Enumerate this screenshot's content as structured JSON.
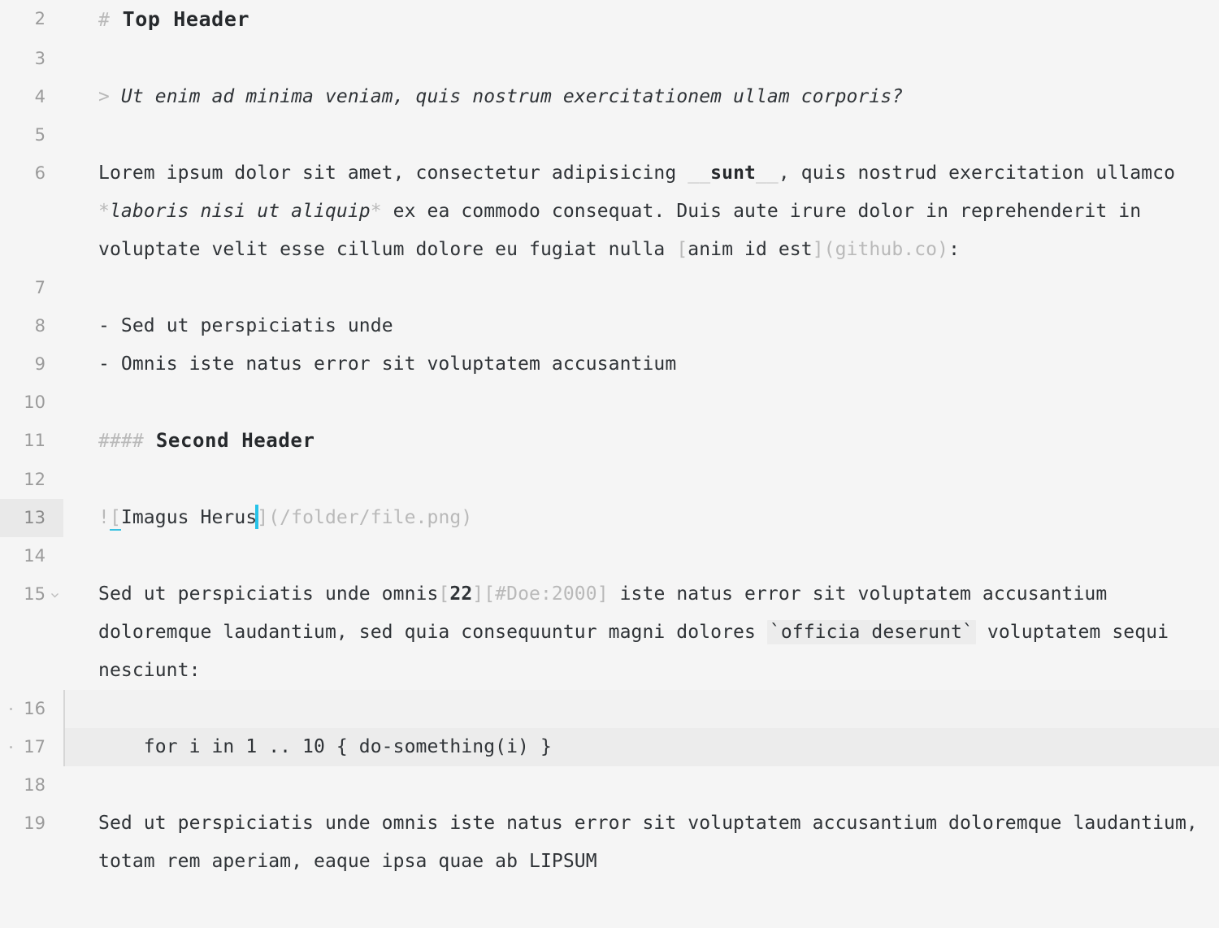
{
  "editor": {
    "kind": "markdown-source-editor",
    "active_line": 13,
    "colors": {
      "background": "#f5f5f5",
      "text": "#2f3337",
      "syntax_marker": "#b9b9b9",
      "gutter_number": "#9b9b9b",
      "active_gutter_background": "#e9e9e9",
      "code_background": "#ececec",
      "caret": "#27c3e8",
      "bracket_match_underline": "#36c0e0",
      "indent_guide": "#d6d6d6"
    }
  },
  "lines": [
    {
      "number": "2",
      "kind": "heading-1",
      "text": "# Top Header",
      "marker": "#",
      "heading_text": "Top Header"
    },
    {
      "number": "3",
      "kind": "blank",
      "text": ""
    },
    {
      "number": "4",
      "kind": "blockquote",
      "text": "> Ut enim ad minima veniam, quis nostrum exercitationem ullam corporis?",
      "marker": ">",
      "quote_text": "Ut enim ad minima veniam, quis nostrum exercitationem ullam corporis?"
    },
    {
      "number": "5",
      "kind": "blank",
      "text": ""
    },
    {
      "number": "6",
      "kind": "paragraph",
      "text": "Lorem ipsum dolor sit amet, consectetur adipisicing __sunt__, quis nostrud exercitation ullamco *laboris nisi ut aliquip* ex ea commodo consequat. Duis aute irure dolor in reprehenderit in voluptate velit esse cillum dolore eu fugiat nulla [anim id est](github.co):",
      "segments": [
        {
          "style": "plain",
          "value": "Lorem ipsum dolor sit amet, consectetur adipisicing "
        },
        {
          "style": "marker",
          "value": "__"
        },
        {
          "style": "bold",
          "value": "sunt"
        },
        {
          "style": "marker",
          "value": "__"
        },
        {
          "style": "plain",
          "value": ", quis nostrud exercitation ullamco "
        },
        {
          "style": "marker",
          "value": "*"
        },
        {
          "style": "italic",
          "value": "laboris nisi ut aliquip"
        },
        {
          "style": "marker",
          "value": "*"
        },
        {
          "style": "plain",
          "value": " ex ea commodo consequat. Duis aute irure dolor in reprehenderit in voluptate velit esse cillum dolore eu fugiat nulla "
        },
        {
          "style": "marker",
          "value": "["
        },
        {
          "style": "plain",
          "value": "anim id est"
        },
        {
          "style": "marker",
          "value": "]("
        },
        {
          "style": "url",
          "value": "github.co"
        },
        {
          "style": "marker",
          "value": ")"
        },
        {
          "style": "plain",
          "value": ":"
        }
      ]
    },
    {
      "number": "7",
      "kind": "blank",
      "text": ""
    },
    {
      "number": "8",
      "kind": "list-item",
      "text": "- Sed ut perspiciatis unde",
      "marker": "-",
      "item_text": "Sed ut perspiciatis unde"
    },
    {
      "number": "9",
      "kind": "list-item",
      "text": "- Omnis iste natus error sit voluptatem accusantium",
      "marker": "-",
      "item_text": "Omnis iste natus error sit voluptatem accusantium"
    },
    {
      "number": "10",
      "kind": "blank",
      "text": ""
    },
    {
      "number": "11",
      "kind": "heading-4",
      "text": "#### Second Header",
      "marker": "####",
      "heading_text": "Second Header"
    },
    {
      "number": "12",
      "kind": "blank",
      "text": ""
    },
    {
      "number": "13",
      "kind": "image-link",
      "active": true,
      "text": "![Imagus Herus](/folder/file.png)",
      "bang": "!",
      "open_bracket": "[",
      "alt_text": "Imagus Herus",
      "close_bracket": "]",
      "url": "(/folder/file.png)",
      "caret_after": "Imagus Herus"
    },
    {
      "number": "14",
      "kind": "blank",
      "text": ""
    },
    {
      "number": "15",
      "kind": "paragraph",
      "foldable": true,
      "text": "Sed ut perspiciatis unde omnis[22][#Doe:2000] iste natus error sit voluptatem accusantium doloremque laudantium, sed quia consequuntur magni dolores `officia deserunt` voluptatem sequi nesciunt:",
      "segments": [
        {
          "style": "plain",
          "value": "Sed ut perspiciatis unde omnis"
        },
        {
          "style": "marker",
          "value": "["
        },
        {
          "style": "cite",
          "value": "22"
        },
        {
          "style": "marker",
          "value": "]"
        },
        {
          "style": "marker",
          "value": "[#Doe:2000]"
        },
        {
          "style": "plain",
          "value": " iste natus error sit voluptatem accusantium doloremque laudantium, sed quia consequuntur magni dolores "
        },
        {
          "style": "code",
          "value": "`officia deserunt`"
        },
        {
          "style": "plain",
          "value": " voluptatem sequi nesciunt:"
        }
      ]
    },
    {
      "number": "16",
      "kind": "code-block-blank",
      "text": ""
    },
    {
      "number": "17",
      "kind": "code-block",
      "text": "    for i in 1 .. 10 { do-something(i) }"
    },
    {
      "number": "18",
      "kind": "blank",
      "text": ""
    },
    {
      "number": "19",
      "kind": "paragraph",
      "text": "Sed ut perspiciatis unde omnis iste natus error sit voluptatem accusantium doloremque laudantium, totam rem aperiam, eaque ipsa quae ab LIPSUM"
    }
  ]
}
